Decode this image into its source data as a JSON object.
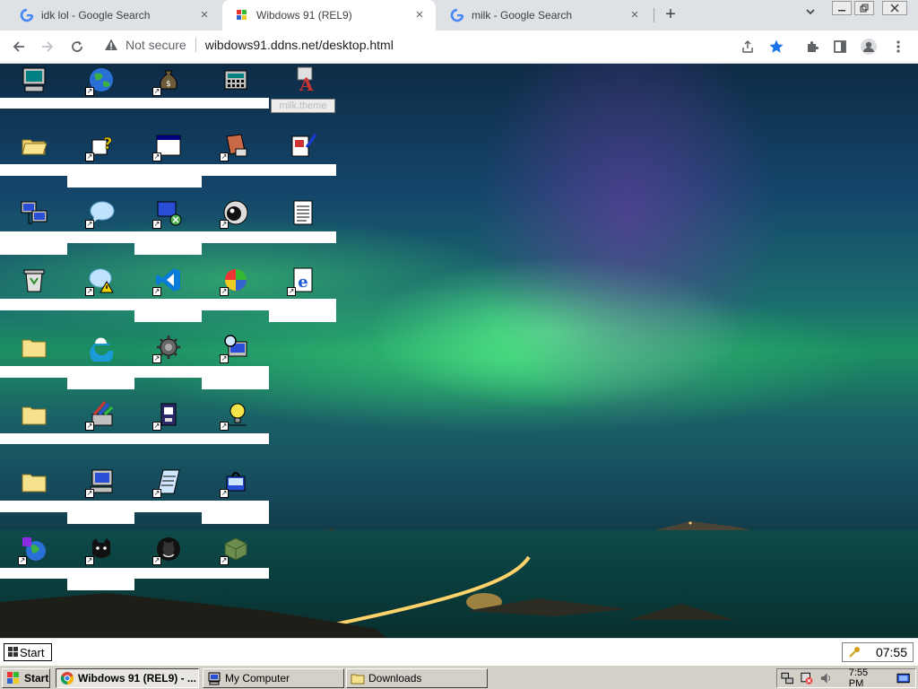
{
  "browser": {
    "tabs": [
      {
        "title": "idk lol - Google Search",
        "active": false
      },
      {
        "title": "Wibdows 91 (REL9)",
        "active": true
      },
      {
        "title": "milk - Google Search",
        "active": false
      }
    ],
    "new_tab": "+",
    "security_label": "Not secure",
    "url": "wibdows91.ddns.net/desktop.html"
  },
  "desktop": {
    "tooltip_label": "milk.theme",
    "icons": [
      "my-computer-icon",
      "globe-icon",
      "money-bag-icon",
      "calculator-icon",
      "font-theme-icon",
      "open-folder-icon",
      "help-icon",
      "window-icon",
      "paint-icon",
      "notepad-edit-icon",
      "network-icon",
      "chat-bubble-icon",
      "disconnect-icon",
      "media-player-icon",
      "document-icon",
      "recycle-bin-icon",
      "warning-icon",
      "vscode-icon",
      "color-wheel-icon",
      "internet-explorer-icon",
      "folder-icon",
      "edge-icon",
      "gear-bug-icon",
      "search-computer-icon",
      "folder-icon",
      "tools-icon",
      "briefcase-icon",
      "tips-icon",
      "folder-icon",
      "computer-icon",
      "writer-icon",
      "installer-icon",
      "globe-app-icon",
      "cat-icon",
      "github-icon",
      "minecraft-icon"
    ]
  },
  "web_taskbar": {
    "start_label": "Start",
    "clock": "07:55"
  },
  "os_taskbar": {
    "start_label": "Start",
    "buttons": [
      {
        "label": "Wibdows 91 (REL9) - ...",
        "pressed": true
      },
      {
        "label": "My Computer",
        "pressed": false
      },
      {
        "label": "Downloads",
        "pressed": false
      }
    ],
    "clock": "7:55 PM"
  },
  "colors": {
    "accent_blue": "#1a73e8",
    "taskbar_gray": "#d4d0c8"
  }
}
